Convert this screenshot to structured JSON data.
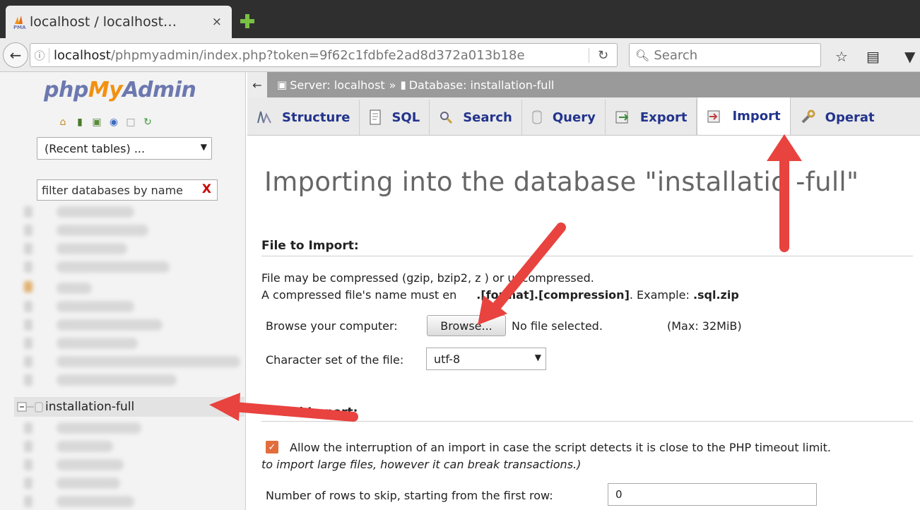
{
  "browser": {
    "tab_title": "localhost / localhost…",
    "tab_close": "×",
    "url_host": "localhost",
    "url_path": "/phpmyadmin/index.php?token=9f62c1fdbfe2ad8d372a013b18e",
    "search_placeholder": "Search"
  },
  "sidebar": {
    "logo_php": "php",
    "logo_my": "My",
    "logo_admin": "Admin",
    "recent_tables": "(Recent tables) ...",
    "filter_placeholder": "filter databases by name",
    "filter_clear": "X",
    "selected_database": "installation-full"
  },
  "breadcrumb": {
    "server": "Server: localhost",
    "separator": "»",
    "database": "Database: installation-full"
  },
  "tabs": [
    {
      "label": "Structure",
      "icon": "structure-icon"
    },
    {
      "label": "SQL",
      "icon": "sql-icon"
    },
    {
      "label": "Search",
      "icon": "search-icon"
    },
    {
      "label": "Query",
      "icon": "query-icon"
    },
    {
      "label": "Export",
      "icon": "export-icon"
    },
    {
      "label": "Import",
      "icon": "import-icon",
      "active": true
    },
    {
      "label": "Operat",
      "icon": "operations-icon"
    }
  ],
  "main": {
    "heading": "Importing into the database \"installatio -full\"",
    "file_section_title": "File to Import:",
    "compress_line1": "File may be compressed (gzip, bzip2, z ) or uncompressed.",
    "compress_line2_a": "A compressed file's name must en",
    "compress_line2_b": ".[format].[compression]",
    "compress_line2_c": ". Example: ",
    "compress_line2_d": ".sql.zip",
    "browse_label": "Browse your computer:",
    "browse_button": "Browse...",
    "no_file": "No file selected.",
    "max_size": "(Max: 32MiB)",
    "charset_label": "Character set of the file:",
    "charset_value": "utf-8",
    "partial_section_title": "tial Import:",
    "allow_interrupt": "Allow the interruption of an import in case the script detects it is close to the PHP timeout limit.",
    "allow_interrupt_note": "to import large files, however it can break transactions.)",
    "skip_label": "Number of rows to skip, starting from the first row:",
    "skip_value": "0"
  },
  "colors": {
    "annotation_arrow": "#e8433f",
    "tab_text": "#23348c",
    "logo_blue": "#6c78af",
    "logo_orange": "#f29111"
  }
}
